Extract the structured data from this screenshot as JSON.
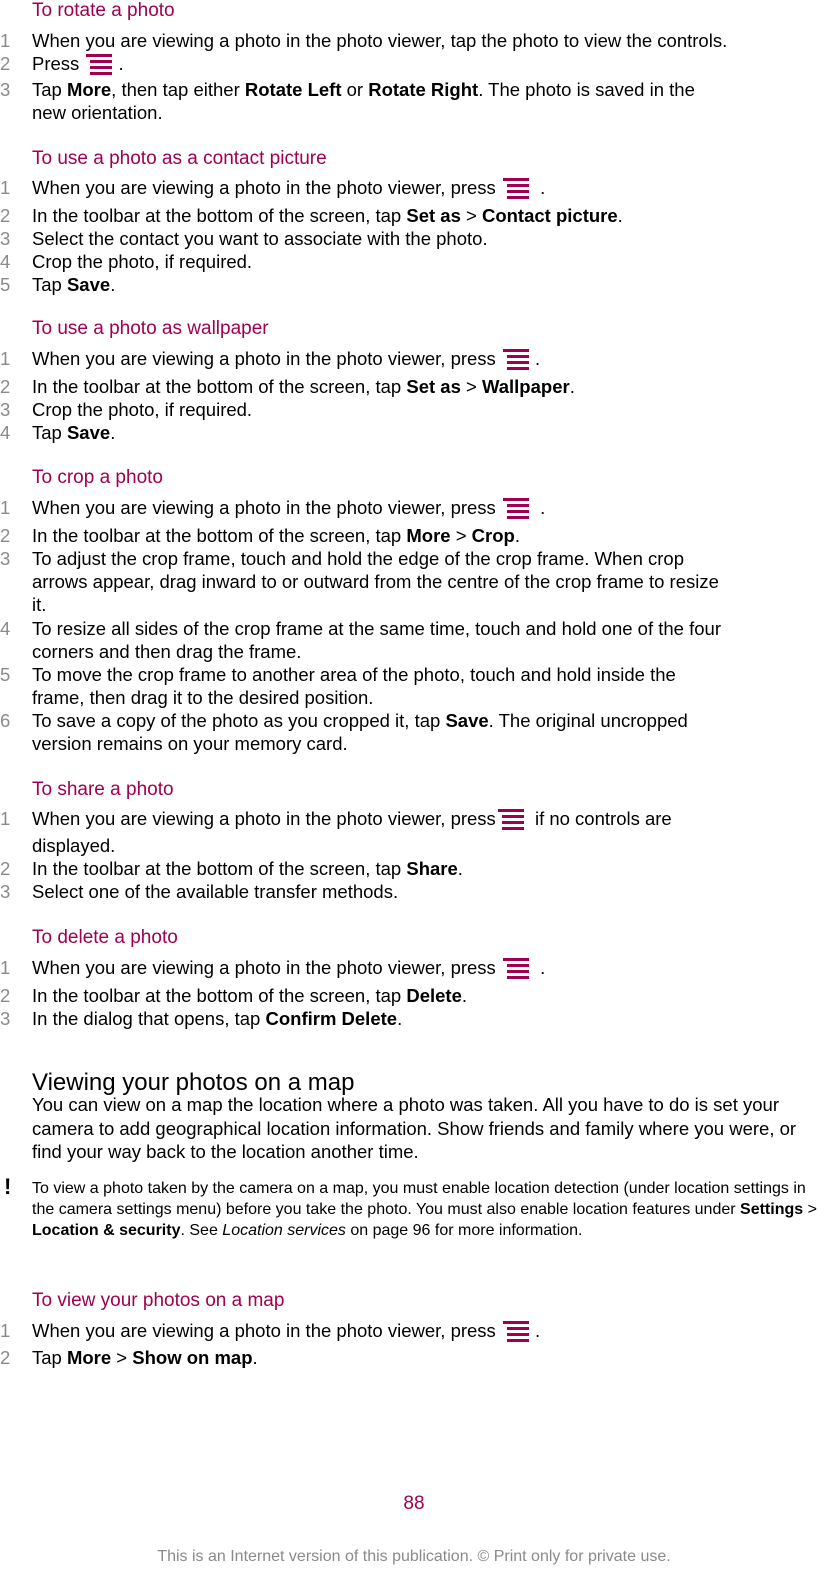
{
  "sections": [
    {
      "title": "To rotate a photo",
      "steps": [
        {
          "num": "1",
          "html": "When you are viewing a photo in the photo viewer, tap the photo to view the controls."
        },
        {
          "num": "2",
          "html": "Press [menu]."
        },
        {
          "num": "3",
          "html": "Tap **More**, then tap either **Rotate Left** or **Rotate Right**. The photo is saved in the<br>new orientation."
        }
      ]
    },
    {
      "title": "To use a photo as a contact picture",
      "steps": [
        {
          "num": "1",
          "html": "When you are viewing a photo in the photo viewer, press [menu] ."
        },
        {
          "num": "2",
          "html": "In the toolbar at the bottom of the screen, tap **Set as** > **Contact picture**."
        },
        {
          "num": "3",
          "html": "Select the contact you want to associate with the photo."
        },
        {
          "num": "4",
          "html": "Crop the photo, if required."
        },
        {
          "num": "5",
          "html": "Tap **Save**."
        }
      ]
    },
    {
      "title": "To use a photo as wallpaper",
      "steps": [
        {
          "num": "1",
          "html": "When you are viewing a photo in the photo viewer, press [menu]."
        },
        {
          "num": "2",
          "html": "In the toolbar at the bottom of the screen, tap **Set as** > **Wallpaper**."
        },
        {
          "num": "3",
          "html": "Crop the photo, if required."
        },
        {
          "num": "4",
          "html": "Tap **Save**."
        }
      ]
    },
    {
      "title": "To crop a photo",
      "steps": [
        {
          "num": "1",
          "html": "When you are viewing a photo in the photo viewer, press [menu] ."
        },
        {
          "num": "2",
          "html": "In the toolbar at the bottom of the screen, tap **More** > **Crop**."
        },
        {
          "num": "3",
          "html": "To adjust the crop frame, touch and hold the edge of the crop frame. When crop<br>arrows appear, drag inward to or outward from the centre of the crop frame to resize<br>it."
        },
        {
          "num": "4",
          "html": "To resize all sides of the crop frame at the same time, touch and hold one of the four<br>corners and then drag the frame."
        },
        {
          "num": "5",
          "html": "To move the crop frame to another area of the photo, touch and hold inside the<br>frame, then drag it to the desired position."
        },
        {
          "num": "6",
          "html": "To save a copy of the photo as you cropped it, tap **Save**. The original uncropped<br>version remains on your memory card."
        }
      ]
    },
    {
      "title": "To share a photo",
      "steps": [
        {
          "num": "1",
          "html": "When you are viewing a photo in the photo viewer, press[menu] if no controls are<br><span style=\"line-height:32px\">displayed.</span>"
        },
        {
          "num": "2",
          "html": "In the toolbar at the bottom of the screen, tap **Share**."
        },
        {
          "num": "3",
          "html": "Select one of the available transfer methods."
        }
      ]
    },
    {
      "title": "To delete a photo",
      "steps": [
        {
          "num": "1",
          "html": "When you are viewing a photo in the photo viewer, press [menu] ."
        },
        {
          "num": "2",
          "html": "In the toolbar at the bottom of the screen, tap **Delete**."
        },
        {
          "num": "3",
          "html": "In the dialog that opens, tap **Confirm Delete**."
        }
      ]
    }
  ],
  "map_section": {
    "heading": "Viewing your photos on a map",
    "paragraph": "You can view on a map the location where a photo was taken. All you have to do is set your camera to add geographical location information. Show friends and family where you were, or find your way back to the location another time.",
    "note_icon": "!",
    "note_html": "To view a photo taken by the camera on a map, you must enable location detection (under location settings in the camera settings menu) before you take the photo. You must also enable location features under **Settings** > **Location & security**. See *Location services* on page 96 for more information.",
    "task": {
      "title": "To view your photos on a map",
      "steps": [
        {
          "num": "1",
          "html": "When you are viewing a photo in the photo viewer, press [menu]."
        },
        {
          "num": "2",
          "html": "Tap **More** > **Show on map**."
        }
      ]
    }
  },
  "page_number": "88",
  "footer": "This is an Internet version of this publication. © Print only for private use.",
  "colors": {
    "accent": "#a0004f",
    "step_number": "#8a8a8a"
  }
}
